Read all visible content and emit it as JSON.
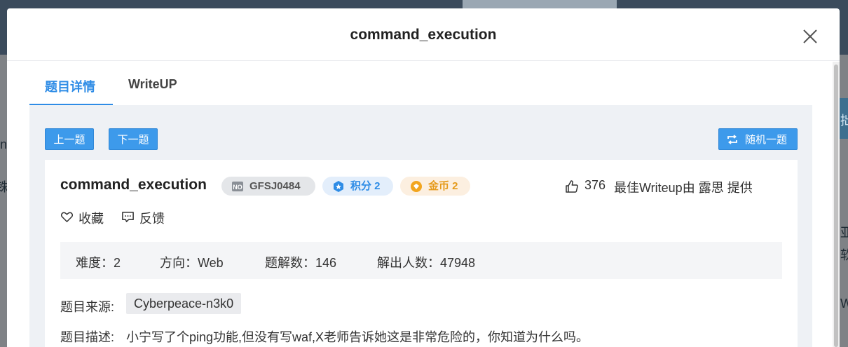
{
  "background": {
    "left_fragments": [
      "n",
      "铢"
    ],
    "right_fragments": [
      "拙",
      "亚",
      "软",
      "W"
    ]
  },
  "modal": {
    "title": "command_execution",
    "close_icon": "close-icon"
  },
  "tabs": [
    {
      "label": "题目详情",
      "active": true
    },
    {
      "label": "WriteUP",
      "active": false
    }
  ],
  "toolbar": {
    "prev_label": "上一题",
    "next_label": "下一题",
    "random_label": "随机一题",
    "random_icon": "shuffle-icon"
  },
  "challenge": {
    "title": "command_execution",
    "id": "GFSJ0484",
    "score": "积分 2",
    "coins": "金币 2",
    "likes": "376",
    "writeup_credit": "最佳Writeup由 露思 提供",
    "favorite_label": "收藏",
    "feedback_label": "反馈",
    "stats": {
      "difficulty": "难度：2",
      "direction": "方向：Web",
      "writeups": "题解数：146",
      "solvers": "解出人数：47948"
    },
    "source_label": "题目来源:",
    "source_value": "Cyberpeace-n3k0",
    "description_label": "题目描述:",
    "description": "小宁写了个ping功能,但没有写waf,X老师告诉她这是非常危险的，你知道为什么吗。"
  },
  "colors": {
    "accent": "#2e8ce6",
    "button_bg": "#3d9aeb",
    "coin": "#e59a1a",
    "panel_bg": "#eef1f5"
  }
}
